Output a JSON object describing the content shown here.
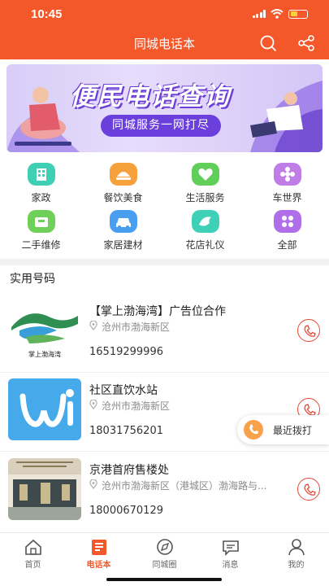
{
  "status_bar": {
    "time": "10:45"
  },
  "header": {
    "title": "同城电话本",
    "search_icon": "search-icon",
    "share_icon": "share-icon",
    "color": "#f4582a"
  },
  "banner": {
    "title": "便民电话查询",
    "subtitle": "同城服务一网打尽"
  },
  "categories": [
    {
      "label": "家政",
      "icon": "building-icon",
      "color": "#3fcfb3"
    },
    {
      "label": "餐饮美食",
      "icon": "food-icon",
      "color": "#f6a13c"
    },
    {
      "label": "生活服务",
      "icon": "heart-icon",
      "color": "#5fcf5a"
    },
    {
      "label": "车世界",
      "icon": "car-flower-icon",
      "color": "#c07de8"
    },
    {
      "label": "二手维修",
      "icon": "repair-icon",
      "color": "#6ed058"
    },
    {
      "label": "家居建材",
      "icon": "car-icon",
      "color": "#4a9ef0"
    },
    {
      "label": "花店礼仪",
      "icon": "bird-icon",
      "color": "#3ed1b7"
    },
    {
      "label": "全部",
      "icon": "grid-icon",
      "color": "#b06fe8"
    }
  ],
  "section": {
    "title": "实用号码"
  },
  "listings": [
    {
      "name": "【掌上渤海湾】广告位合作",
      "address": "沧州市渤海新区",
      "phone": "16519299996",
      "logo_text": "掌上渤海湾"
    },
    {
      "name": "社区直饮水站",
      "address": "沧州市渤海新区",
      "phone": "18031756201"
    },
    {
      "name": "京港首府售楼处",
      "address": "沧州市渤海新区（港城区）渤海路与...",
      "phone": "18000670129"
    }
  ],
  "recent_call": {
    "label": "最近拨打"
  },
  "tabbar": [
    {
      "label": "首页",
      "icon": "home-icon",
      "active": false
    },
    {
      "label": "电话本",
      "icon": "phonebook-icon",
      "active": true
    },
    {
      "label": "同城圈",
      "icon": "compass-icon",
      "active": false
    },
    {
      "label": "消息",
      "icon": "message-icon",
      "active": false
    },
    {
      "label": "我的",
      "icon": "user-icon",
      "active": false
    }
  ]
}
